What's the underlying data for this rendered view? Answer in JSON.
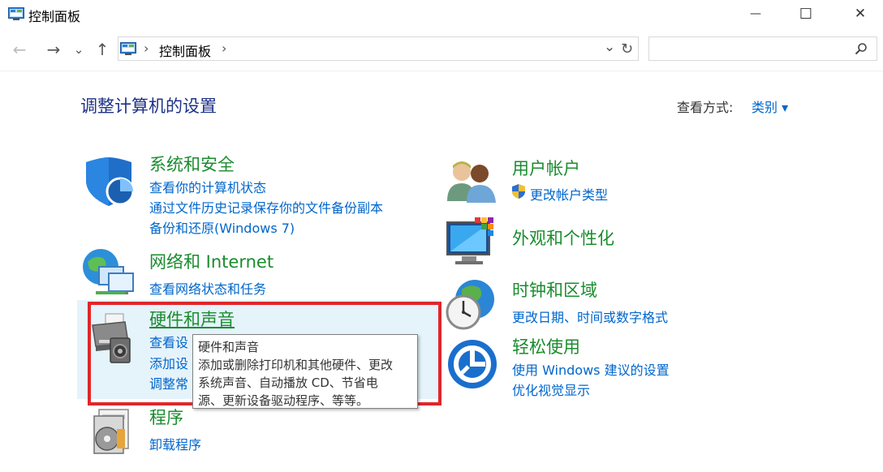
{
  "window": {
    "title": "控制面板",
    "minimize_glyph": "—",
    "maximize_glyph": "☐",
    "close_glyph": "✕"
  },
  "nav": {
    "back_glyph": "←",
    "forward_glyph": "→",
    "recent_glyph": "⌄",
    "up_glyph": "↑",
    "breadcrumb": [
      "控制面板"
    ],
    "breadcrumb_sep": "›",
    "dropdown_glyph": "⌄",
    "refresh_glyph": "↻",
    "search_placeholder": ""
  },
  "main": {
    "heading": "调整计算机的设置",
    "view_by_label": "查看方式:",
    "view_by_value": "类别 ▾"
  },
  "categories_left": [
    {
      "title": "系统和安全",
      "links": [
        "查看你的计算机状态",
        "通过文件历史记录保存你的文件备份副本",
        "备份和还原(Windows 7)"
      ]
    },
    {
      "title": "网络和 Internet",
      "links": [
        "查看网络状态和任务"
      ]
    },
    {
      "title": "硬件和声音",
      "links": [
        "查看设",
        "添加设",
        "调整常"
      ]
    },
    {
      "title": "程序",
      "links": [
        "卸载程序"
      ]
    }
  ],
  "categories_right": [
    {
      "title": "用户帐户",
      "links": [
        "更改帐户类型"
      ]
    },
    {
      "title": "外观和个性化",
      "links": []
    },
    {
      "title": "时钟和区域",
      "links": [
        "更改日期、时间或数字格式"
      ]
    },
    {
      "title": "轻松使用",
      "links": [
        "使用 Windows 建议的设置",
        "优化视觉显示"
      ]
    }
  ],
  "tooltip": {
    "title": "硬件和声音",
    "lines": [
      "添加或删除打印机和其他硬件、更改",
      "系统声音、自动播放 CD、节省电",
      "源、更新设备驱动程序、等等。"
    ]
  },
  "colors": {
    "title_green": "#1a8c2e",
    "link_blue": "#0066cc",
    "heading_navy": "#1e3287",
    "highlight_red": "#e0262b"
  },
  "icons": {
    "system_security": "shield-icon",
    "network": "network-globe-icon",
    "hardware_sound": "printer-speaker-icon",
    "programs": "program-disc-icon",
    "user_accounts": "users-icon",
    "appearance": "monitor-palette-icon",
    "clock_region": "clock-globe-icon",
    "ease_of_access": "ease-of-access-icon"
  }
}
